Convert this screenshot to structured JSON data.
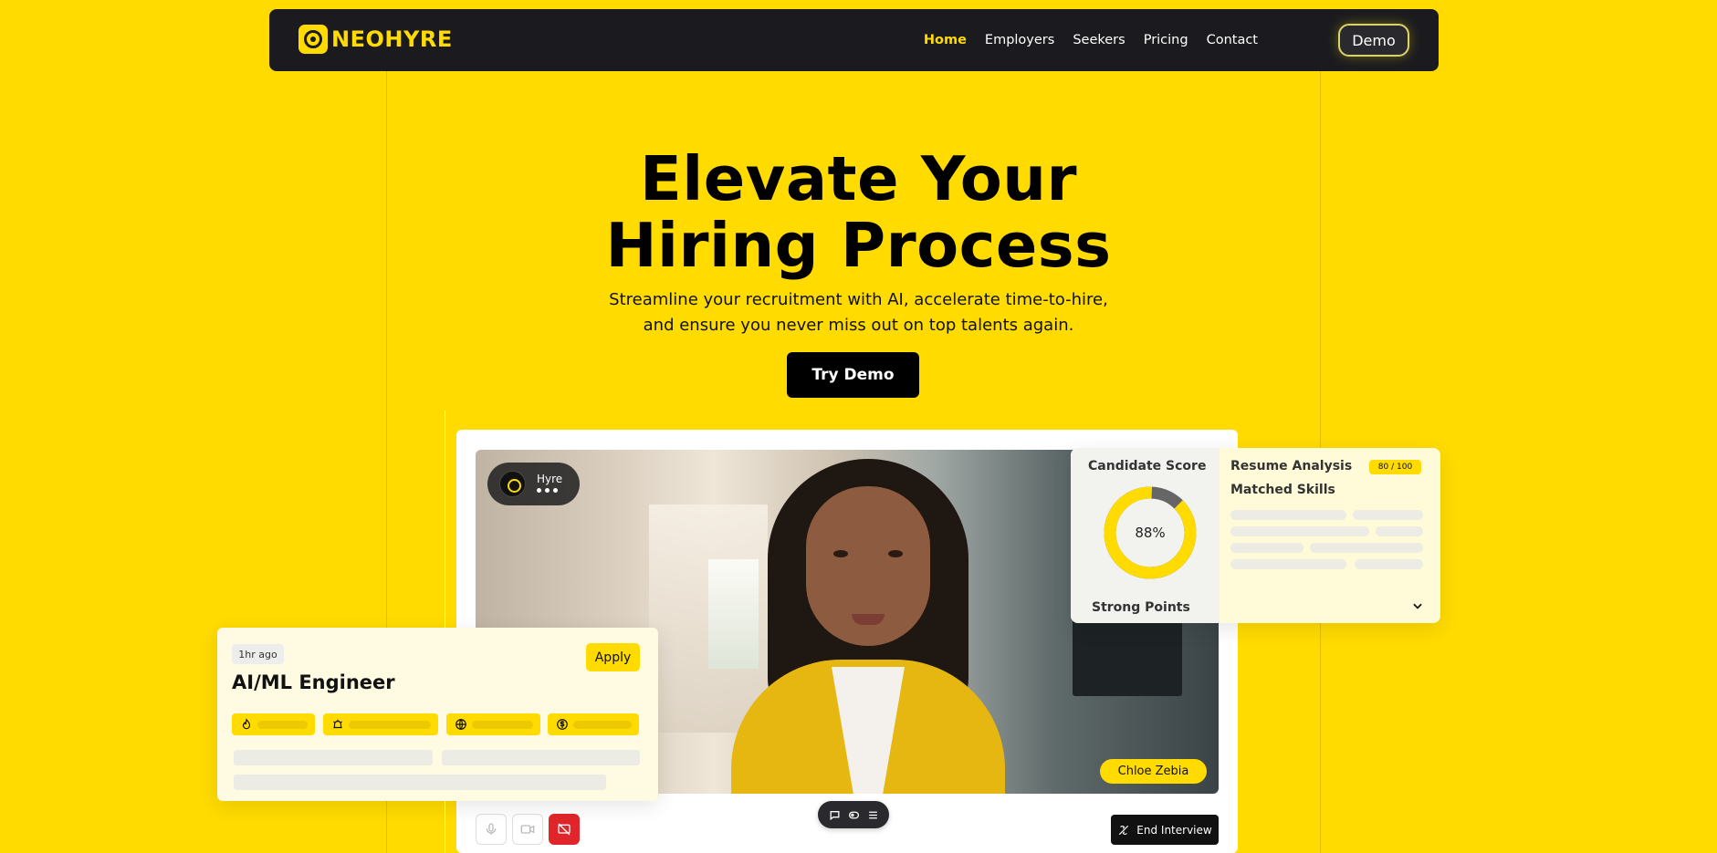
{
  "nav": {
    "brand": "NEOHYRE",
    "links": [
      "Home",
      "Employers",
      "Seekers",
      "Pricing",
      "Contact"
    ],
    "demo_label": "Demo"
  },
  "hero": {
    "title_line1": "Elevate Your",
    "title_line2": "Hiring Process",
    "subtitle_line1": "Streamline your recruitment with AI, accelerate time-to-hire,",
    "subtitle_line2": "and ensure you never miss out on top talents again.",
    "cta_label": "Try Demo"
  },
  "interview": {
    "assistant_name": "Hyre",
    "candidate_name": "Chloe Zebia",
    "end_label": "End Interview"
  },
  "score": {
    "title": "Candidate Score",
    "percent": 88,
    "percent_label": "88%",
    "strong_points": "Strong Points",
    "resume_title": "Resume Analysis",
    "resume_badge": "80 / 100",
    "matched_title": "Matched Skills"
  },
  "job": {
    "posted": "1hr ago",
    "title": "AI/ML Engineer",
    "apply_label": "Apply"
  },
  "colors": {
    "accent": "#FFDB00",
    "dark": "#1b1b1f",
    "danger": "#e0262a"
  }
}
